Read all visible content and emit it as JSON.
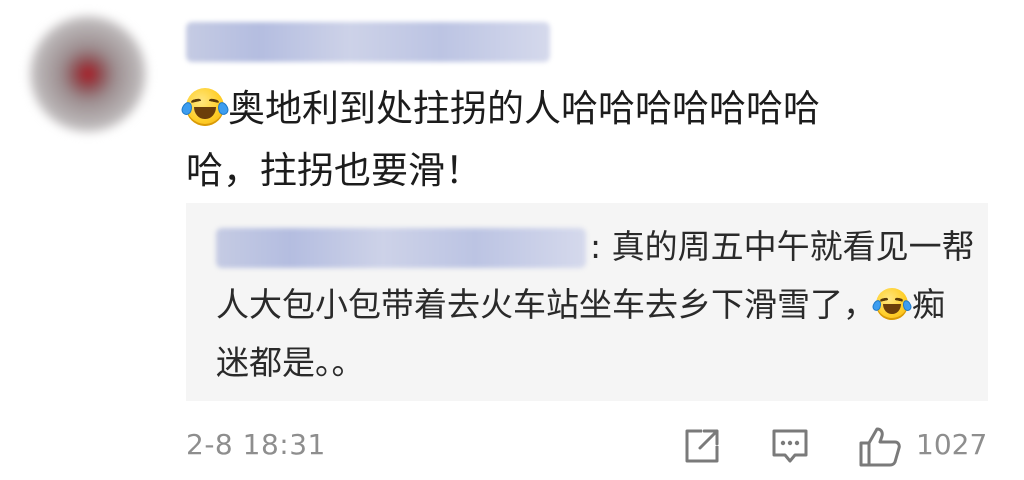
{
  "comment": {
    "author_name": "",
    "emoji_name": "laughing-with-tears-emoji",
    "text_line1": "奥地利到处拄拐的人哈哈哈哈哈哈哈",
    "text_line2": "哈，拄拐也要滑！",
    "reply": {
      "author_name": "",
      "separator": ": ",
      "text_part1": "真的周五中午就看见一帮人大包小包带着去火车站坐车去乡下滑雪了，",
      "text_part2": "痴迷都是。。"
    },
    "timestamp": "2-8 18:31",
    "actions": {
      "share_icon": "share-icon",
      "reply_icon": "comment-icon",
      "like_icon": "thumbs-up-icon",
      "like_count": "1027"
    }
  },
  "colors": {
    "text": "#1c1c1c",
    "muted": "#8e8e8e",
    "reply_bg": "#f5f5f5",
    "blur_name": "#c5cbe3"
  }
}
